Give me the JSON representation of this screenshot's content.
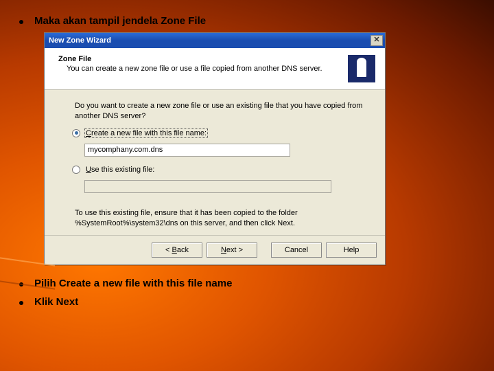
{
  "bullets": {
    "b1": "Maka akan tampil jendela Zone File",
    "b2": "Pilih Create a new file with this file name",
    "b3": "Klik Next"
  },
  "wizard": {
    "title": "New Zone Wizard",
    "close": "✕",
    "header_title": "Zone File",
    "header_sub": "You can create a new zone file or use a file copied from another DNS server.",
    "question": "Do you want to create a new zone file or use an existing file that you have copied from another DNS server?",
    "opt_create_pre": "C",
    "opt_create_rest": "reate a new file with this file name:",
    "opt_existing_pre": "U",
    "opt_existing_rest": "se this existing file:",
    "filename": "mycomphany.com.dns",
    "existing_value": "",
    "hint": "To use this existing file, ensure that it has been copied to the folder %SystemRoot%\\system32\\dns on this server, and then click Next.",
    "btn_back_pre": "< ",
    "btn_back_u": "B",
    "btn_back_rest": "ack",
    "btn_next_u": "N",
    "btn_next_rest": "ext >",
    "btn_cancel": "Cancel",
    "btn_help": "Help"
  }
}
